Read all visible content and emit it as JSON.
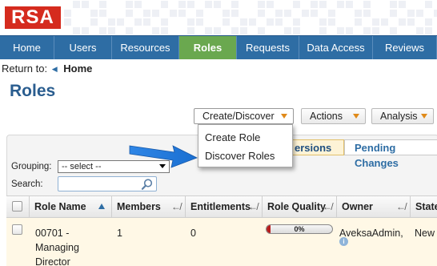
{
  "brand": {
    "logo_text": "RSA",
    "accent": "#d52b1e"
  },
  "nav": {
    "items": [
      {
        "label": "Home"
      },
      {
        "label": "Users"
      },
      {
        "label": "Resources"
      },
      {
        "label": "Roles",
        "active": true
      },
      {
        "label": "Requests"
      },
      {
        "label": "Data Access"
      },
      {
        "label": "Reviews"
      }
    ],
    "color": "#2e6da4",
    "active_color": "#6aa84f"
  },
  "breadcrumb": {
    "prefix": "Return to:",
    "home": "Home"
  },
  "page": {
    "title": "Roles"
  },
  "toolbar": {
    "create": "Create/Discover",
    "actions": "Actions",
    "analysis": "Analysis"
  },
  "menu": {
    "items": [
      "Create Role",
      "Discover Roles"
    ]
  },
  "tabs": {
    "versions": "ersions",
    "pending": "Pending Changes"
  },
  "filters": {
    "grouping_label": "Grouping:",
    "grouping_value": "-- select --",
    "search_label": "Search:",
    "search_value": ""
  },
  "table": {
    "columns": [
      "Role Name",
      "Members",
      "Entitlements",
      "Role Quality",
      "Owner",
      "State"
    ],
    "rows": [
      {
        "name": "00701 - Managing Director",
        "name_lines": [
          "00701 -",
          "Managing",
          "Director"
        ],
        "members": "1",
        "entitlements": "0",
        "quality": "0%",
        "quality_value": 0,
        "owner": "AveksaAdmin,",
        "state": "New"
      }
    ]
  },
  "icons": [
    "search-icon",
    "info-icon",
    "dropdown-caret-icon",
    "sort-icon",
    "arrow-callout-icon"
  ]
}
